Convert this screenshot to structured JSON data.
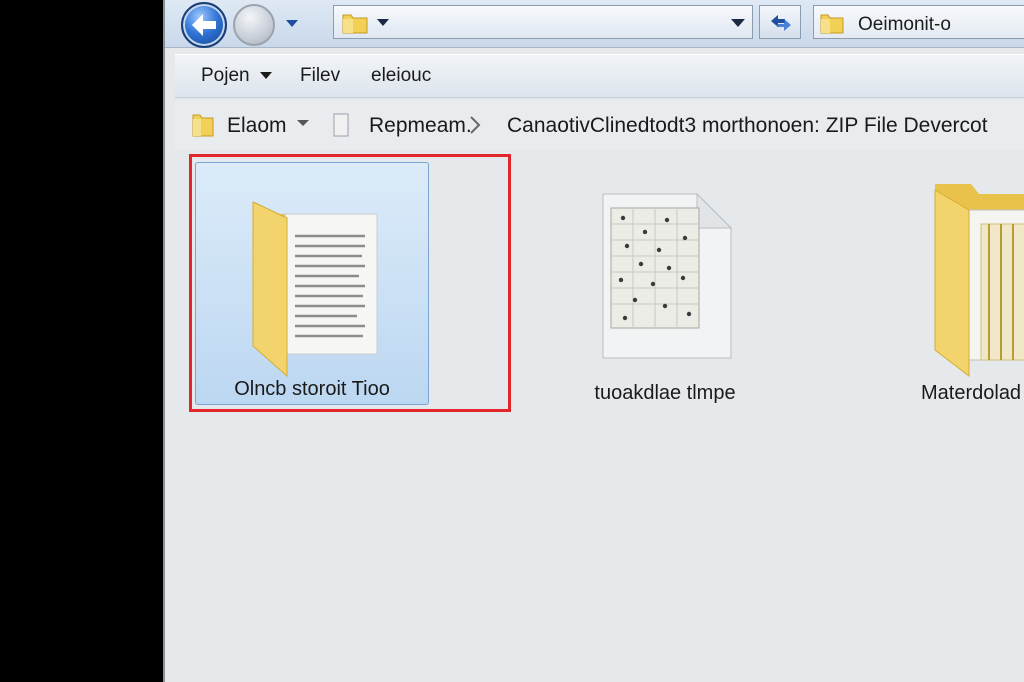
{
  "address_bar": {
    "search_text": "Oeimonit-o"
  },
  "menu": {
    "items": [
      {
        "label": "Pojen",
        "has_caret": true
      },
      {
        "label": "Filev",
        "has_caret": false
      },
      {
        "label": "eleiouc",
        "has_caret": false
      }
    ]
  },
  "breadcrumb": {
    "items": [
      {
        "label": "Elaom"
      },
      {
        "label": "Repmeam."
      },
      {
        "label": "CanaotivClinedtodt3 morthonoen: ZIP File Devercot"
      }
    ]
  },
  "files": [
    {
      "label": "Olncb storoit Tioo",
      "icon": "folder-with-document-icon",
      "selected": true
    },
    {
      "label": "tuoakdlae tlmpe",
      "icon": "document-icon",
      "selected": false
    },
    {
      "label": "Materdolad",
      "icon": "folder-icon",
      "selected": false
    }
  ],
  "colors": {
    "highlight": "#e2262b",
    "selection": "#bcd7f1",
    "folder": "#f2d36b"
  }
}
